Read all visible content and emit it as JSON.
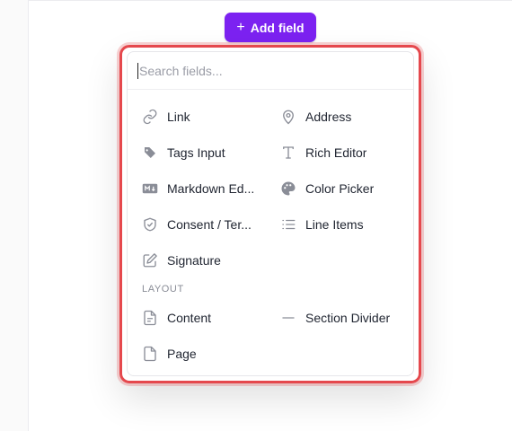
{
  "toolbar": {
    "add_field_label": "Add field",
    "add_field_icon": "+",
    "accent": "#7c22f1"
  },
  "popover": {
    "highlight_color": "#e5484d",
    "search": {
      "placeholder": "Search fields...",
      "value": ""
    },
    "fields": [
      {
        "label": "Link",
        "icon": "link-icon"
      },
      {
        "label": "Address",
        "icon": "map-pin-icon"
      },
      {
        "label": "Tags Input",
        "icon": "tags-icon"
      },
      {
        "label": "Rich Editor",
        "icon": "text-type-icon"
      },
      {
        "label": "Markdown Ed...",
        "icon": "markdown-icon"
      },
      {
        "label": "Color Picker",
        "icon": "palette-icon"
      },
      {
        "label": "Consent / Ter...",
        "icon": "shield-check-icon"
      },
      {
        "label": "Line Items",
        "icon": "list-icon"
      },
      {
        "label": "Signature",
        "icon": "pencil-square-icon"
      }
    ],
    "layout_section": {
      "title": "LAYOUT",
      "items": [
        {
          "label": "Content",
          "icon": "document-text-icon"
        },
        {
          "label": "Section Divider",
          "icon": "minus-icon"
        },
        {
          "label": "Page",
          "icon": "document-icon"
        }
      ]
    }
  }
}
